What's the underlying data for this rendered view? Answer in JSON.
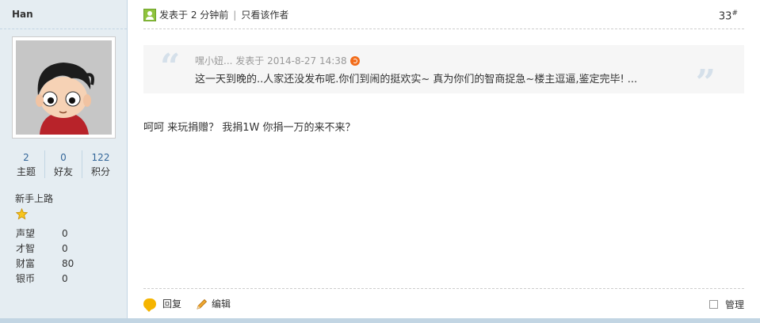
{
  "user": {
    "name": "Han",
    "stats": [
      {
        "num": "2",
        "label": "主题"
      },
      {
        "num": "0",
        "label": "好友"
      },
      {
        "num": "122",
        "label": "积分"
      }
    ],
    "rank": "新手上路",
    "attrs": [
      {
        "k": "声望",
        "v": "0"
      },
      {
        "k": "才智",
        "v": "0"
      },
      {
        "k": "财富",
        "v": "80"
      },
      {
        "k": "银币",
        "v": "0"
      }
    ]
  },
  "post": {
    "posted_at": "发表于 2 分钟前",
    "author_only": "只看该作者",
    "floor": "33",
    "floor_mark": "#",
    "quote": {
      "meta": "嘿小妞... 发表于 2014-8-27 14:38",
      "text": "这一天到晚的..人家还没发布呢.你们到闹的挺欢实~ 真为你们的智商捉急~楼主逗逼,鉴定完毕! ..."
    },
    "message": "呵呵 来玩捐赠？ 我捐1W 你捐一万的来不来？"
  },
  "actions": {
    "reply": "回复",
    "edit": "编辑",
    "manage": "管理"
  },
  "icons": [
    "online-user-icon",
    "quote-goto-icon",
    "reply-icon",
    "edit-pencil-icon",
    "rank-star-icon"
  ]
}
